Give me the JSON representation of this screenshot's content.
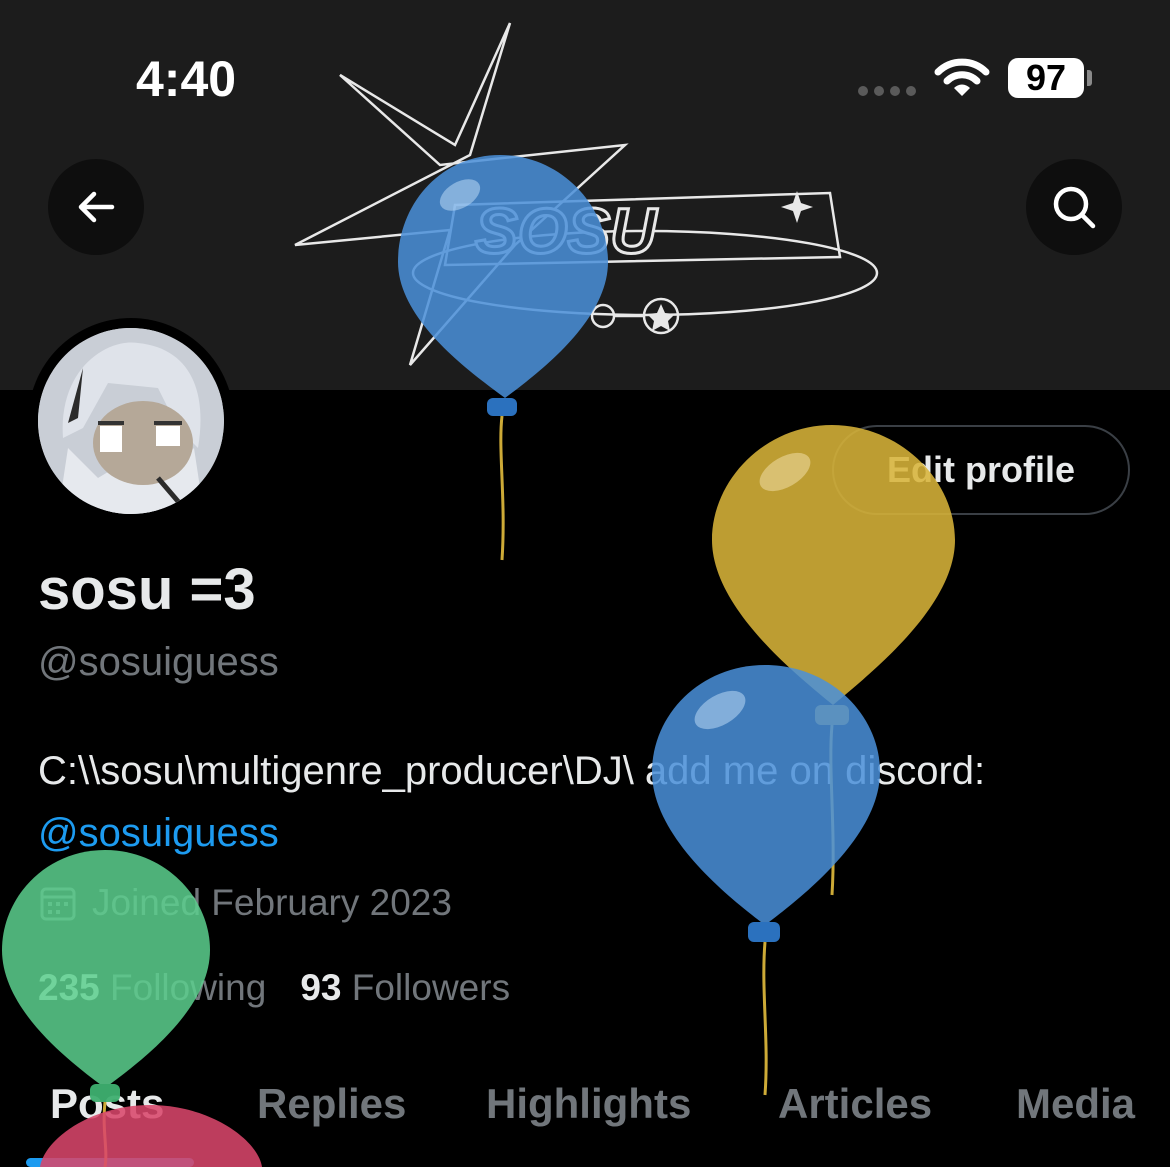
{
  "status_bar": {
    "time": "4:40",
    "battery": "97"
  },
  "banner": {
    "logo_text": "SOSU"
  },
  "profile": {
    "display_name": "sosu =3",
    "handle": "@sosuiguess",
    "edit_button": "Edit profile",
    "bio_prefix": "C:\\\\sosu\\multigenre_producer\\DJ\\ add me on discord: ",
    "bio_mention": "@sosuiguess",
    "joined": "Joined February 2023",
    "following_count": "235",
    "following_label": "Following",
    "followers_count": "93",
    "followers_label": "Followers"
  },
  "tabs": [
    {
      "label": "Posts",
      "active": true
    },
    {
      "label": "Replies",
      "active": false
    },
    {
      "label": "Highlights",
      "active": false
    },
    {
      "label": "Articles",
      "active": false
    },
    {
      "label": "Media",
      "active": false
    }
  ],
  "colors": {
    "accent": "#1d9bf0",
    "balloon_blue": "#4a90d9",
    "balloon_yellow": "#d9b43a",
    "balloon_green": "#5ccf8e",
    "balloon_red": "#d9476a"
  }
}
